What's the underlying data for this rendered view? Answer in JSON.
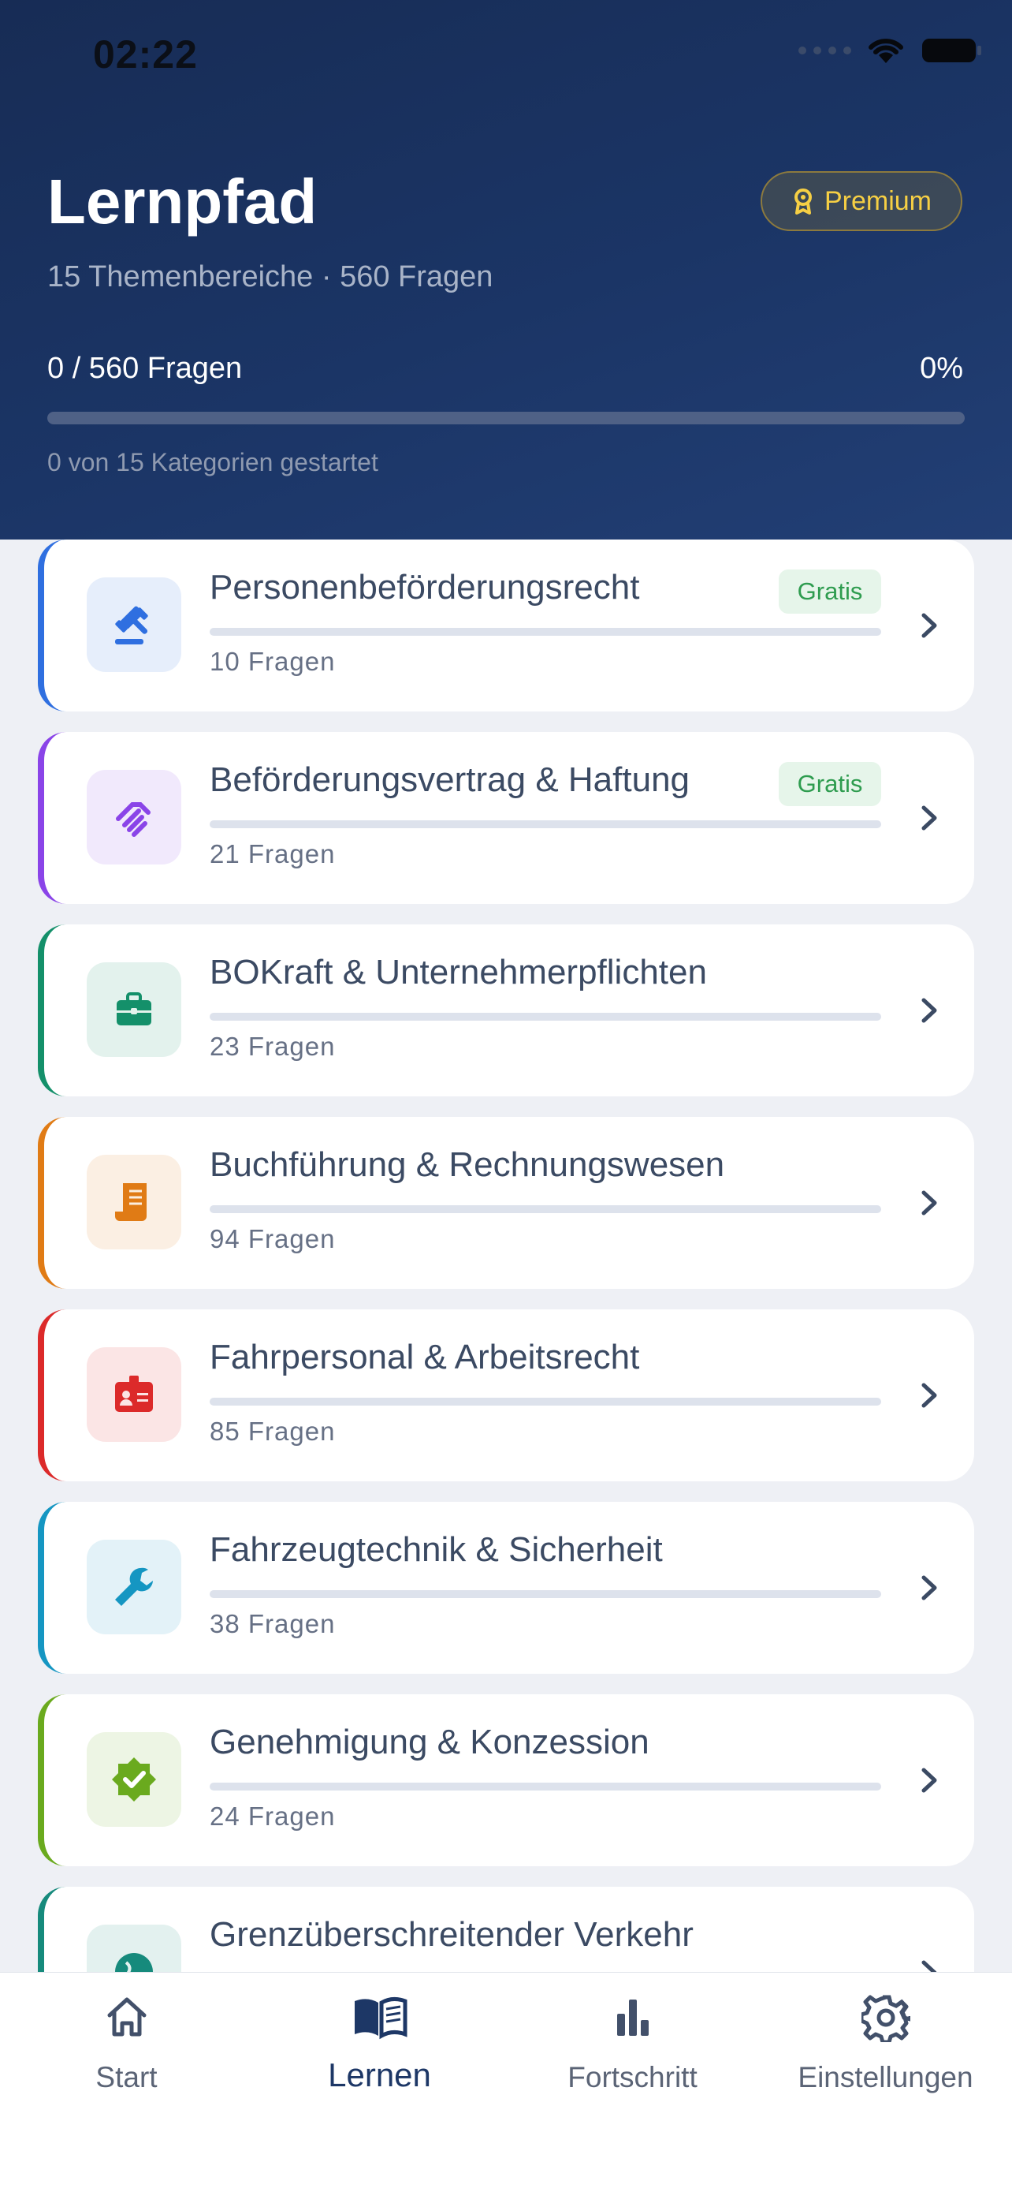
{
  "status_bar": {
    "time": "02:22"
  },
  "header": {
    "title": "Lernpfad",
    "subtitle": "15 Themenbereiche · 560 Fragen",
    "premium_label": "Premium",
    "progress_label": "0 / 560 Fragen",
    "progress_percent": "0%",
    "progress_value": 0,
    "started_text": "0 von 15 Kategorien gestartet"
  },
  "categories": [
    {
      "title": "Personenbeförderungsrecht",
      "count": "10 Fragen",
      "badge": "Gratis",
      "icon": "gavel-icon",
      "color": "#2f6fe0",
      "progress": 0
    },
    {
      "title": "Beförderungsvertrag & Haftung",
      "count": "21 Fragen",
      "badge": "Gratis",
      "icon": "handshake-icon",
      "color": "#8a44e8",
      "progress": 0
    },
    {
      "title": "BOKraft & Unternehmerpflichten",
      "count": "23 Fragen",
      "icon": "briefcase-icon",
      "color": "#14906a",
      "progress": 0
    },
    {
      "title": "Buchführung & Rechnungswesen",
      "count": "94 Fragen",
      "icon": "receipt-icon",
      "color": "#e07b15",
      "progress": 0
    },
    {
      "title": "Fahrpersonal & Arbeitsrecht",
      "count": "85 Fragen",
      "icon": "id-badge-icon",
      "color": "#dc2a2a",
      "progress": 0
    },
    {
      "title": "Fahrzeugtechnik & Sicherheit",
      "count": "38 Fragen",
      "icon": "wrench-icon",
      "color": "#1596c2",
      "progress": 0
    },
    {
      "title": "Genehmigung & Konzession",
      "count": "24 Fragen",
      "icon": "verified-badge-icon",
      "color": "#6aaa1e",
      "progress": 0
    },
    {
      "title": "Grenzüberschreitender Verkehr",
      "count": "",
      "icon": "globe-icon",
      "color": "#168a7c",
      "progress": 0
    }
  ],
  "tabs": [
    {
      "label": "Start",
      "icon": "home-icon",
      "active": false
    },
    {
      "label": "Lernen",
      "icon": "book-icon",
      "active": true
    },
    {
      "label": "Fortschritt",
      "icon": "bar-chart-icon",
      "active": false
    },
    {
      "label": "Einstellungen",
      "icon": "gear-icon",
      "active": false
    }
  ]
}
